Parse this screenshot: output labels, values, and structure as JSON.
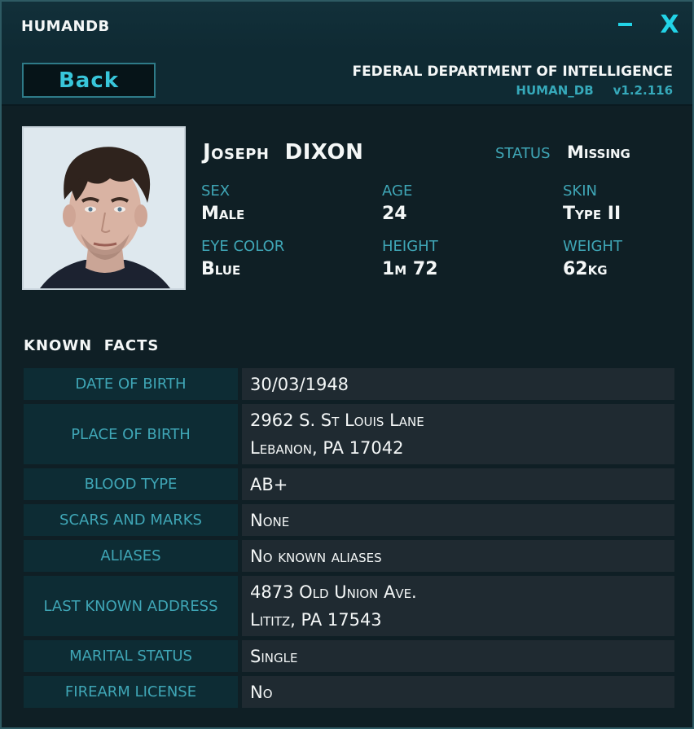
{
  "window": {
    "title": "HUMANDB",
    "minimize_icon": "minimize-icon",
    "close_glyph": "X"
  },
  "header": {
    "back_label": "Back",
    "agency": "FEDERAL DEPARTMENT OF INTELLIGENCE",
    "db_name": "HUMAN_DB",
    "version": "v1.2.116"
  },
  "profile": {
    "first_name": "Joseph",
    "last_name": "DIXON",
    "status_label": "STATUS",
    "status_value": "Missing",
    "stats": [
      {
        "label": "SEX",
        "value": "Male"
      },
      {
        "label": "AGE",
        "value": "24"
      },
      {
        "label": "SKIN",
        "value": "Type II"
      },
      {
        "label": "EYE COLOR",
        "value": "Blue"
      },
      {
        "label": "HEIGHT",
        "value": "1m 72"
      },
      {
        "label": "WEIGHT",
        "value": "62kg"
      }
    ]
  },
  "facts": {
    "title": "KNOWN  FACTS",
    "rows": [
      {
        "label": "DATE OF BIRTH",
        "lines": [
          "30/03/1948"
        ]
      },
      {
        "label": "PLACE OF BIRTH",
        "lines": [
          "2962 S. St Louis Lane",
          "Lebanon, PA 17042"
        ]
      },
      {
        "label": "BLOOD TYPE",
        "lines": [
          "AB+"
        ]
      },
      {
        "label": "SCARS AND MARKS",
        "lines": [
          "None"
        ]
      },
      {
        "label": "ALIASES",
        "lines": [
          "No known aliases"
        ]
      },
      {
        "label": "LAST KNOWN ADDRESS",
        "lines": [
          "4873 Old Union Ave.",
          "Lititz, PA 17543"
        ]
      },
      {
        "label": "MARITAL STATUS",
        "lines": [
          "Single"
        ]
      },
      {
        "label": "FIREARM LICENSE",
        "lines": [
          "No"
        ]
      }
    ]
  },
  "colors": {
    "accent": "#22d3e6",
    "label": "#3fa6b6",
    "panel": "#0f1f25",
    "value_bg": "#1f2a31",
    "label_bg": "#0d2c34"
  }
}
